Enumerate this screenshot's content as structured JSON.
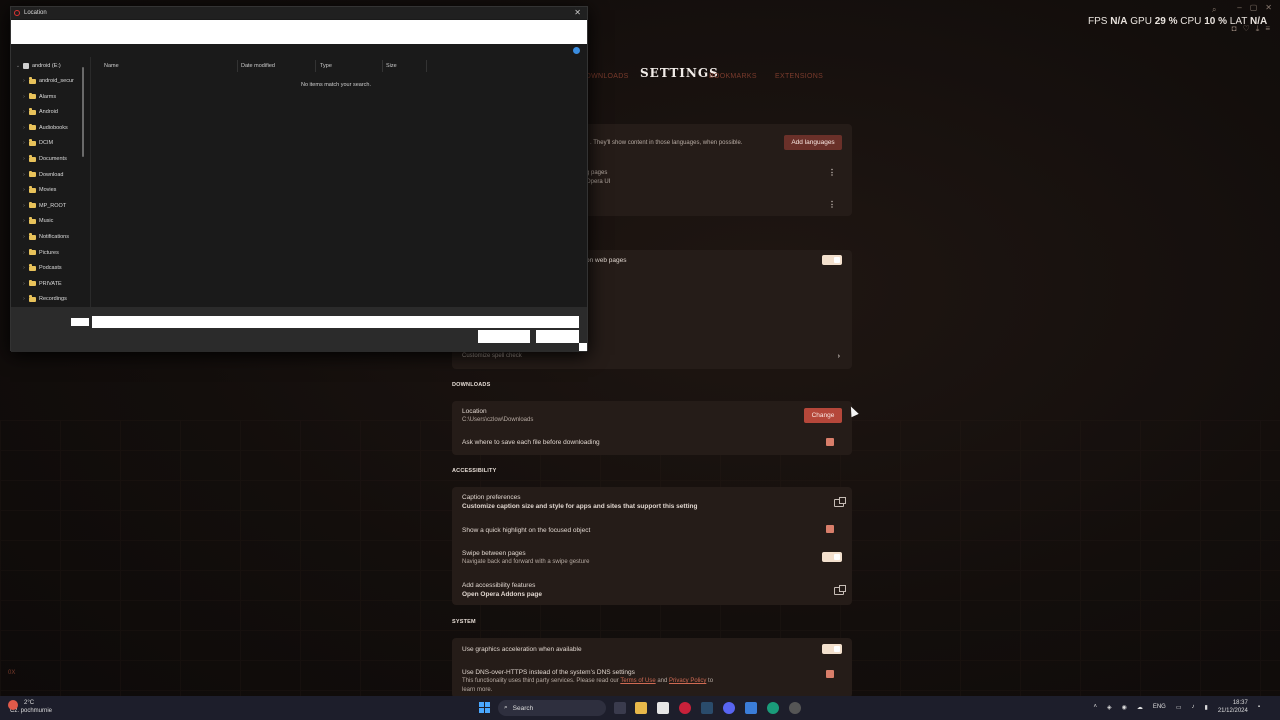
{
  "overlay": {
    "fps_label": "FPS",
    "fps_value": "N/A",
    "gpu_label": "GPU",
    "gpu_value": "29 %",
    "cpu_label": "CPU",
    "cpu_value": "10 %",
    "lat_label": "LAT",
    "lat_value": "N/A"
  },
  "nav": {
    "downloads": "DOWNLOADS",
    "title": "SETTINGS",
    "bookmarks": "BOOKMARKS",
    "extensions": "EXTENSIONS"
  },
  "languages": {
    "desc": ". They'll show content in those languages, when possible.",
    "add_button": "Add languages",
    "lang_line1": "g pages",
    "lang_line2": "Opera UI"
  },
  "spell": {
    "label": "on web pages",
    "customize": "Customize spell check"
  },
  "downloads": {
    "section": "DOWNLOADS",
    "location_label": "Location",
    "location_path": "C:\\Users\\czlow\\Downloads",
    "change_button": "Change",
    "ask_label": "Ask where to save each file before downloading"
  },
  "accessibility": {
    "section": "ACCESSIBILITY",
    "caption_title": "Caption preferences",
    "caption_sub": "Customize caption size and style for apps and sites that support this setting",
    "highlight": "Show a quick highlight on the focused object",
    "swipe_title": "Swipe between pages",
    "swipe_sub": "Navigate back and forward with a swipe gesture",
    "add_title": "Add accessibility features",
    "add_sub": "Open Opera Addons page"
  },
  "system": {
    "section": "SYSTEM",
    "gpu_accel": "Use graphics acceleration when available",
    "dns_title": "Use DNS-over-HTTPS instead of the system's DNS settings",
    "dns_sub_a": "This functionality uses third party services. Please read our",
    "terms": "Terms of Use",
    "and": "and",
    "privacy": "Privacy Policy",
    "to": "to",
    "learn": "learn more."
  },
  "dialog": {
    "title": "Location",
    "close": "✕",
    "columns": [
      "Name",
      "Date modified",
      "Type",
      "Size"
    ],
    "empty_message": "No items match your search.",
    "drive": "android (E:)",
    "folders": [
      "android_secur",
      "Alarms",
      "Android",
      "Audiobooks",
      "DCIM",
      "Documents",
      "Download",
      "Movies",
      "MP_ROOT",
      "Music",
      "Notifications",
      "Pictures",
      "Podcasts",
      "PRIVATE",
      "Recordings"
    ]
  },
  "taskbar": {
    "temp": "2°C",
    "weather": "Cz. pochmurnie",
    "search": "Search",
    "lang": "ENG",
    "time": "18:37",
    "date": "21/12/2024"
  },
  "side_mark": "0X"
}
